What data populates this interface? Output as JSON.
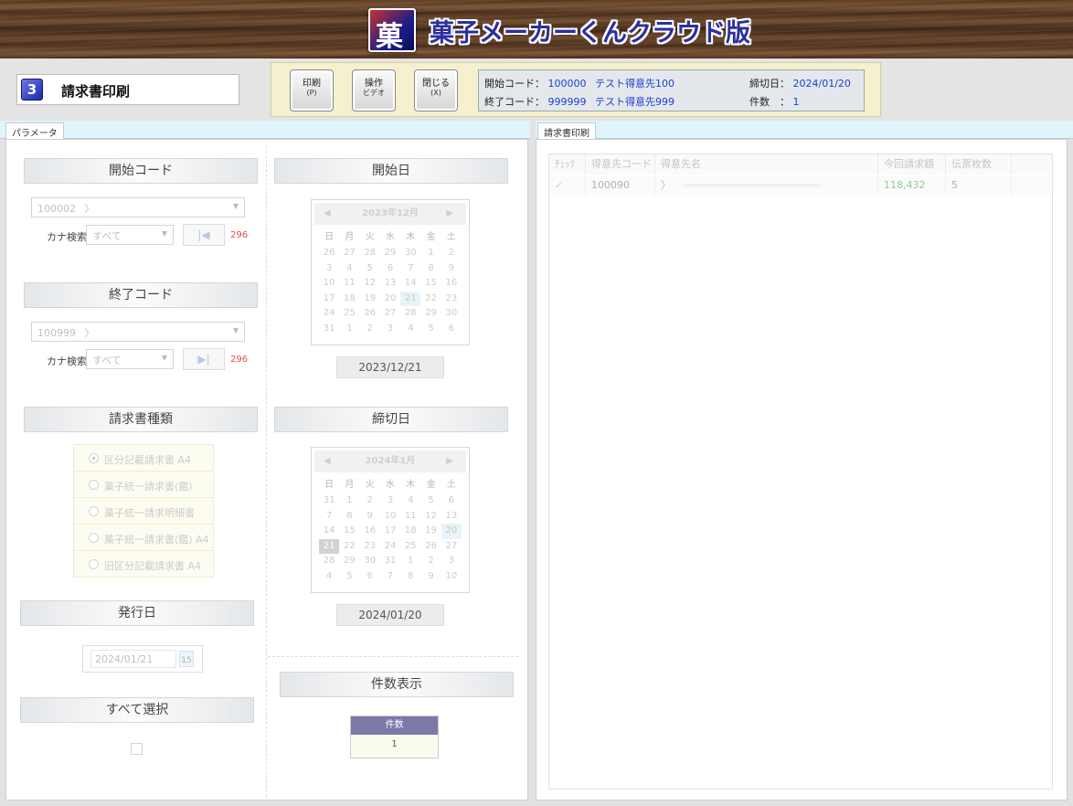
{
  "app": {
    "title": "菓子メーカーくんクラウド版",
    "logo_glyph": "菓"
  },
  "screen": {
    "number": "3",
    "title": "請求書印刷"
  },
  "toolbar": {
    "print_label": "印刷",
    "print_key": "(P)",
    "video_label": "操作",
    "video_sub": "ビデオ",
    "close_label": "閉じる",
    "close_key": "(X)"
  },
  "info": {
    "start_code_label": "開始コード：",
    "start_code": "100000",
    "start_name": "テスト得意先100",
    "end_code_label": "終了コード：",
    "end_code": "999999",
    "end_name": "テスト得意先999",
    "closing_label": "締切日：",
    "closing_date": "2024/01/20",
    "count_label": "件数　：",
    "count": "1"
  },
  "left_panel": {
    "tab": "パラメータ",
    "start_code": {
      "header": "開始コード",
      "combo_value": "100002",
      "combo_suffix": "〉",
      "kana_label": "カナ検索",
      "kana_value": "すべて",
      "nav_glyph": "|◀",
      "count": "296"
    },
    "end_code": {
      "header": "終了コード",
      "combo_value": "100999",
      "combo_suffix": "〉",
      "kana_label": "カナ検索",
      "kana_value": "すべて",
      "nav_glyph": "▶|",
      "count": "296"
    },
    "invoice_type": {
      "header": "請求書種類",
      "options": [
        "区分記載請求書 A4",
        "菓子統一請求書(鑑)",
        "菓子統一請求明細書",
        "菓子統一請求書(鑑) A4",
        "旧区分記載請求書 A4"
      ],
      "selected_index": 0
    },
    "issue_date": {
      "header": "発行日",
      "value": "2024/01/21",
      "icon_label": "15"
    },
    "select_all": {
      "header": "すべて選択"
    },
    "start_date": {
      "header": "開始日",
      "cal_title": "2023年12月",
      "prev": "◀",
      "next": "▶",
      "weekdays": [
        "日",
        "月",
        "火",
        "水",
        "木",
        "金",
        "土"
      ],
      "days": [
        "26",
        "27",
        "28",
        "29",
        "30",
        "1",
        "2",
        "3",
        "4",
        "5",
        "6",
        "7",
        "8",
        "9",
        "10",
        "11",
        "12",
        "13",
        "14",
        "15",
        "16",
        "17",
        "18",
        "19",
        "20",
        "21",
        "22",
        "23",
        "24",
        "25",
        "26",
        "27",
        "28",
        "29",
        "30",
        "31",
        "1",
        "2",
        "3",
        "4",
        "5",
        "6"
      ],
      "selected_index": 25,
      "value": "2023/12/21"
    },
    "closing_date": {
      "header": "締切日",
      "cal_title": "2024年1月",
      "prev": "◀",
      "next": "▶",
      "weekdays": [
        "日",
        "月",
        "火",
        "水",
        "木",
        "金",
        "土"
      ],
      "days": [
        "31",
        "1",
        "2",
        "3",
        "4",
        "5",
        "6",
        "7",
        "8",
        "9",
        "10",
        "11",
        "12",
        "13",
        "14",
        "15",
        "16",
        "17",
        "18",
        "19",
        "20",
        "21",
        "22",
        "23",
        "24",
        "25",
        "26",
        "27",
        "28",
        "29",
        "30",
        "31",
        "1",
        "2",
        "3",
        "4",
        "5",
        "6",
        "7",
        "8",
        "9",
        "10"
      ],
      "selected_index": 20,
      "current_index": 21,
      "value": "2024/01/20"
    },
    "count_display": {
      "header": "件数表示",
      "col": "件数",
      "value": "1"
    }
  },
  "right_panel": {
    "tab": "請求書印刷",
    "columns": [
      "ﾁｪｯｸ",
      "得意先コード",
      "得意先名",
      "今回請求額",
      "伝票枚数"
    ],
    "rows": [
      {
        "check": "✓",
        "code": "100090",
        "name": "〉",
        "amount": "118,432",
        "slips": "5"
      }
    ]
  },
  "colors": {
    "accent_blue": "#1a3fd0",
    "title_blue": "#2b2f9e",
    "count_red": "#e05050",
    "amount_green": "#7ac47a"
  }
}
